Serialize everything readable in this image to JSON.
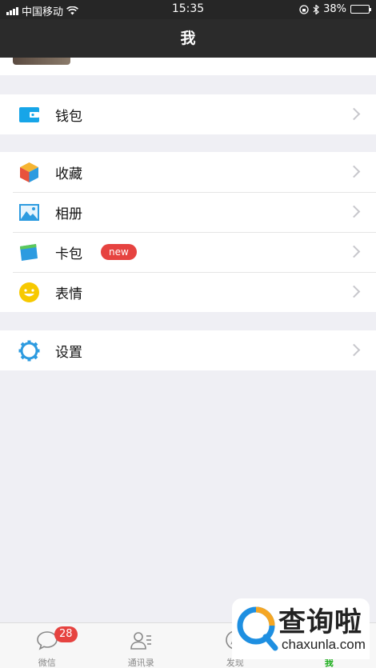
{
  "status_bar": {
    "carrier": "中国移动",
    "time": "15:35",
    "battery": "38%",
    "battery_level": 0.38
  },
  "nav": {
    "title": "我"
  },
  "groups": {
    "wallet": {
      "label": "钱包"
    },
    "collection": {
      "label": "收藏"
    },
    "album": {
      "label": "相册"
    },
    "cards": {
      "label": "卡包",
      "badge": "new"
    },
    "stickers": {
      "label": "表情"
    },
    "settings": {
      "label": "设置"
    }
  },
  "tab_bar": {
    "tabs": [
      {
        "label": "微信",
        "badge": "28",
        "icon": "chat-icon"
      },
      {
        "label": "通讯录",
        "icon": "contacts-icon"
      },
      {
        "label": "发现",
        "icon": "discover-icon"
      },
      {
        "label": "我",
        "icon": "me-icon",
        "active": true
      }
    ]
  },
  "watermark": {
    "title": "查询啦",
    "url": "chaxunla.com"
  },
  "colors": {
    "accent_green": "#1aad19",
    "badge_red": "#e64340",
    "nav_bg": "#2b2b2b",
    "page_bg": "#efeff4"
  }
}
